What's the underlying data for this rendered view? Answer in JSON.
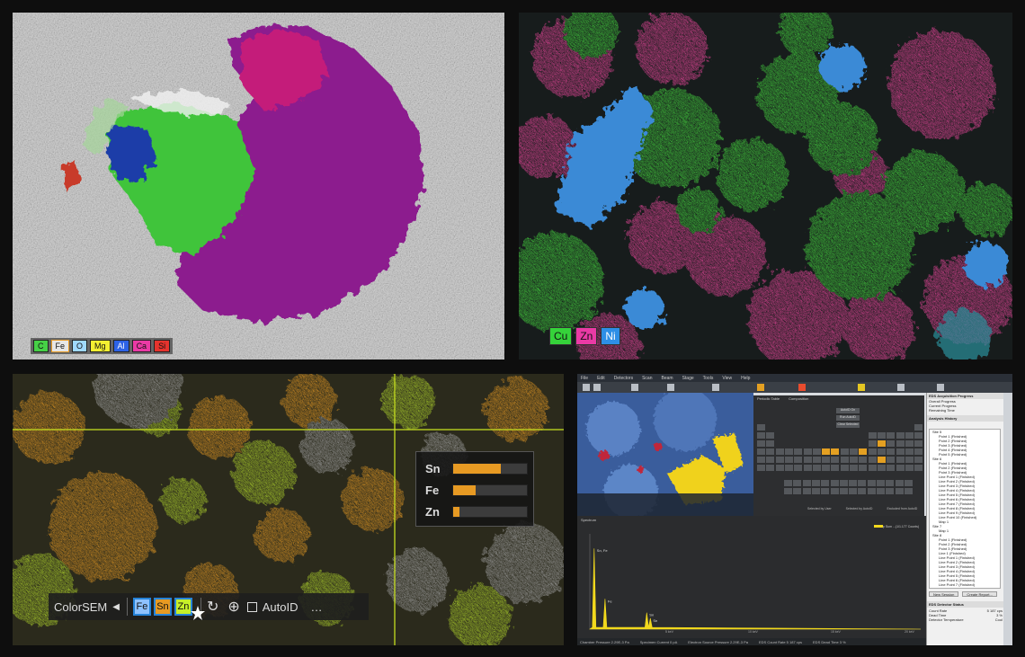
{
  "panel1": {
    "legend": [
      {
        "label": "C",
        "color": "#46d046"
      },
      {
        "label": "Fe",
        "color": "#e6e6e6"
      },
      {
        "label": "O",
        "color": "#9fd8ff"
      },
      {
        "label": "Mg",
        "color": "#f3ef31"
      },
      {
        "label": "Al",
        "color": "#2d63e6"
      },
      {
        "label": "Ca",
        "color": "#ea3aa5"
      },
      {
        "label": "Si",
        "color": "#e5332d"
      }
    ]
  },
  "panel2": {
    "legend": [
      {
        "label": "Cu",
        "color": "#35d23a"
      },
      {
        "label": "Zn",
        "color": "#ea3aa5"
      },
      {
        "label": "Ni",
        "color": "#2d8fe6"
      }
    ]
  },
  "panel3": {
    "meter": [
      {
        "label": "Sn",
        "level": 0.65
      },
      {
        "label": "Fe",
        "level": 0.3
      },
      {
        "label": "Zn",
        "level": 0.08
      }
    ],
    "toolbar": {
      "title": "ColorSEM",
      "collapse_glyph": "◀",
      "elements": [
        {
          "label": "Fe",
          "color": "#8fc2ff"
        },
        {
          "label": "Sn",
          "color": "#e79a23"
        },
        {
          "label": "Zn",
          "color": "#c6f02a"
        }
      ],
      "refresh_glyph": "↻",
      "target_glyph": "⊕",
      "autoid_label": "AutoID",
      "more_glyph": "…"
    }
  },
  "panel4": {
    "menu": [
      "File",
      "Edit",
      "Detectors",
      "Scan",
      "Beam",
      "Stage",
      "Tools",
      "View",
      "Help"
    ],
    "tab_periodic": "Periodic Table",
    "tab_composition": "Composition",
    "buttons": [
      "AutoID On",
      "Run AutoID",
      "Clear Selected"
    ],
    "legend": [
      "Selected by User",
      "Selected by AutoID",
      "Excluded from AutoID"
    ],
    "spectrum_label": "Spectrum",
    "spectrum_legend": "Map Sum ...(1/1.177 Counts)",
    "x_ticks": [
      "5 keV",
      "10 keV",
      "15 keV",
      "20 keV"
    ],
    "peak_labels": [
      "Sn, Fe",
      "Fe",
      "Sn",
      "Sn"
    ],
    "peak_x": [
      0.26,
      0.92,
      3.44,
      3.66
    ],
    "peak_heights": [
      0.88,
      0.33,
      0.18,
      0.12
    ],
    "right_pane": {
      "title": "EDS Acquisition Progress",
      "lines": [
        "Overall Progress",
        "Current Progress",
        "Remaining Time"
      ],
      "history_title": "Analysis History",
      "history": [
        "Site 5",
        "Point 1 (Finished)",
        "Point 2 (Finished)",
        "Point 3 (Finished)",
        "Point 4 (Finished)",
        "Point 5 (Finished)",
        "Site 6",
        "Point 1 (Finished)",
        "Point 2 (Finished)",
        "Point 3 (Finished)",
        "Line Point 1 (Finished)",
        "Line Point 2 (Finished)",
        "Line Point 3 (Finished)",
        "Line Point 4 (Finished)",
        "Line Point 5 (Finished)",
        "Line Point 6 (Finished)",
        "Line Point 7 (Finished)",
        "Line Point 8 (Finished)",
        "Line Point 9 (Finished)",
        "Line Point 10 (Finished)",
        "Map 1",
        "Site 7",
        "Map 1",
        "Site 8",
        "Point 1 (Finished)",
        "Point 2 (Finished)",
        "Point 3 (Finished)",
        "Line 1 (Finished)",
        "Line Point 1 (Finished)",
        "Line Point 2 (Finished)",
        "Line Point 3 (Finished)",
        "Line Point 4 (Finished)",
        "Line Point 5 (Finished)",
        "Line Point 6 (Finished)",
        "Line Point 7 (Finished)",
        "Line Point 8 (Finished)",
        "Line Point 9 (Finished)",
        "Line Point 10 (Finished)"
      ],
      "new_session": "New Session",
      "create_report": "Create Report...",
      "detector_title": "EDS Detector Status",
      "detector_lines": [
        "Count Rate",
        "Dead Time",
        "Detector Temperature"
      ],
      "detector_values": [
        "5 187 cps",
        "3 %",
        "Cool"
      ]
    },
    "status": [
      "Chamber Pressure  2.29E-3 Pa",
      "Specimen Current  0 pA",
      "Electron Source Pressure  2.29E-3 Pa",
      "EDS Count Rate  5 187 cps",
      "EDS Dead Time  3 %"
    ]
  }
}
